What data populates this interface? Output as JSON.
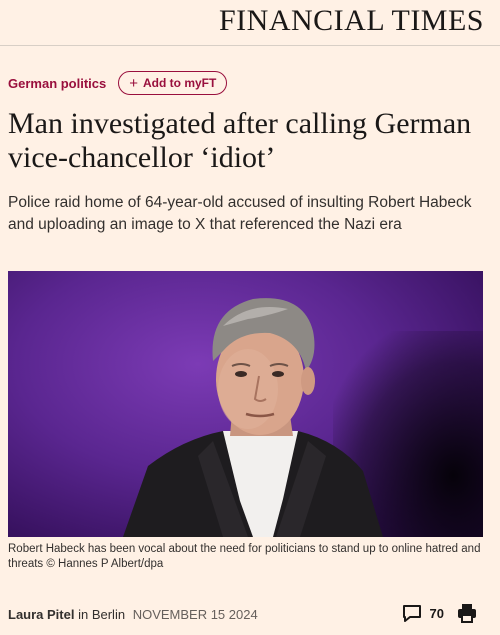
{
  "masthead": {
    "logo": "FINANCIAL TIMES"
  },
  "topic": {
    "label": "German politics",
    "myft_label": "Add to myFT",
    "plus": "+"
  },
  "article": {
    "headline": "Man investigated after calling German vice-chancellor ‘idiot’",
    "standfirst": "Police raid home of 64-year-old accused of insulting Robert Habeck and uploading an image to X that referenced the Nazi era",
    "caption": "Robert Habeck has been vocal about the need for politicians to stand up to online hatred and threats © Hannes P Albert/dpa"
  },
  "byline": {
    "author": "Laura Pitel",
    "location": "in Berlin",
    "date": "NOVEMBER 15 2024"
  },
  "tools": {
    "comment_count": "70",
    "comment_icon": "speech-bubble-icon",
    "print_icon": "printer-icon"
  },
  "colors": {
    "background": "#fff1e5",
    "accent": "#990f3d",
    "text": "#33302e"
  }
}
